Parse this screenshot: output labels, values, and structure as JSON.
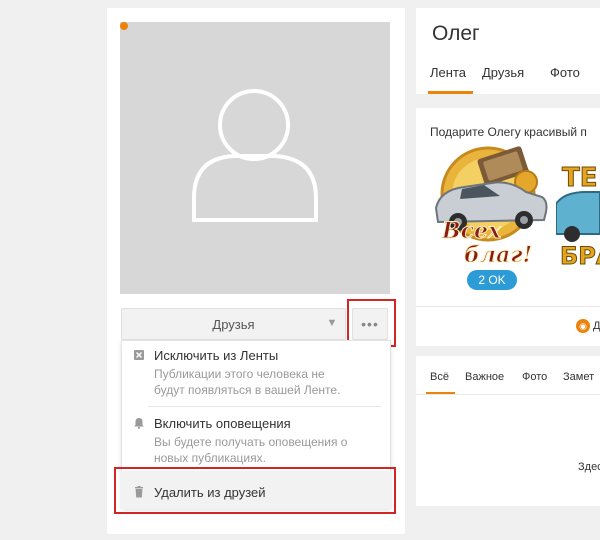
{
  "profile": {
    "friends_button": "Друзья",
    "friends_caret": "▼",
    "more_button": "•••"
  },
  "menu": {
    "items": [
      {
        "title": "Исключить из Ленты",
        "desc_lines": [
          "Публикации этого человека не",
          "будут появляться в вашей Ленте."
        ],
        "icon": "hide-from-feed-icon"
      },
      {
        "title": "Включить оповещения",
        "desc_lines": [
          "Вы будете получать оповещения о",
          "новых публикациях."
        ],
        "icon": "bell-icon"
      },
      {
        "title": "Удалить из друзей",
        "icon": "trash-icon"
      }
    ]
  },
  "header": {
    "name": "Олег",
    "tabs": [
      "Лента",
      "Друзья",
      "Фото"
    ]
  },
  "gift": {
    "text": "Подарите Олегу красивый п",
    "gift1_line1": "Всех",
    "gift1_line2": "благ!",
    "gift2_partial_1": "ТЕ",
    "gift2_partial_2": "БРА",
    "price": "2 OK",
    "partial_label": "Д"
  },
  "feed": {
    "tabs": [
      "Всё",
      "Важное",
      "Фото",
      "Замет"
    ],
    "partial_text": "Здес"
  },
  "colors": {
    "accent_orange": "#ee8208",
    "highlight_red": "#d02626",
    "badge_blue": "#2c9bd6"
  }
}
